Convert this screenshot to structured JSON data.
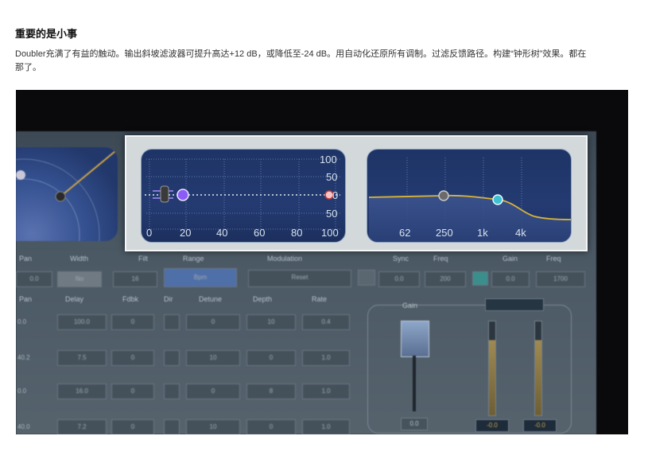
{
  "article": {
    "title": "重要的是小事",
    "description": "Doubler充满了有益的触动。输出斜坡滤波器可提升高达+12 dB，或降低至-24 dB。用自动化还原所有调制。过滤反馈路径。构建“钟形树”效果。都在那了。"
  },
  "screenshot": {
    "left_panel": {
      "scale_right": [
        "100",
        "50",
        "0",
        "50",
        "100"
      ],
      "scale_bottom": [
        "0",
        "20",
        "40",
        "60",
        "80",
        "100"
      ]
    },
    "right_panel": {
      "freq_labels": [
        "62",
        "250",
        "1k",
        "4k"
      ]
    },
    "params_row1": {
      "labels": [
        "Pan",
        "Width",
        "Filt",
        "Range",
        "Modulation",
        "Sync",
        "Freq",
        "Gain",
        "Freq"
      ],
      "values": [
        "0.0",
        "No",
        "16",
        "Bpm",
        "Reset",
        "0.0",
        "200",
        "0.0",
        "1700"
      ]
    },
    "params_row2": {
      "labels": [
        "Pan",
        "Delay",
        "Fdbk",
        "Dir",
        "Detune",
        "Depth",
        "Rate"
      ]
    },
    "rows": [
      {
        "label": "0.0",
        "cells": [
          "100.0",
          "0",
          "",
          "0",
          "10",
          "0.4"
        ]
      },
      {
        "label": "40.2",
        "cells": [
          "7.5",
          "0",
          "",
          "10",
          "0",
          "1.0"
        ]
      },
      {
        "label": "0.0",
        "cells": [
          "16.0",
          "0",
          "",
          "0",
          "8",
          "1.0"
        ]
      },
      {
        "label": "40.0",
        "cells": [
          "7.2",
          "0",
          "",
          "10",
          "0",
          "1.0"
        ]
      }
    ],
    "gain": {
      "title": "Gain",
      "value": "0.0",
      "meter_values": [
        "-0.0",
        "-0.0"
      ]
    },
    "colors": {
      "panel_blue": "#243b72",
      "curve_yellow": "#d9b43a",
      "node_purple": "#8b5cf6",
      "node_teal": "#3fbfd0"
    }
  }
}
